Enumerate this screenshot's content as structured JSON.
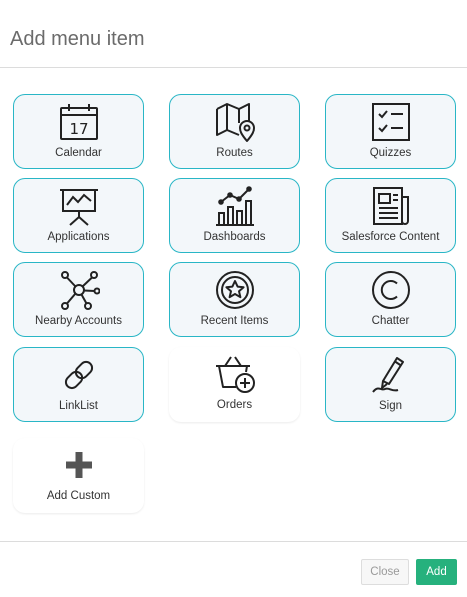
{
  "dialog": {
    "title": "Add menu item"
  },
  "tiles": [
    {
      "label": "Calendar",
      "icon": "calendar-icon",
      "calendar_day": "17",
      "selected": true
    },
    {
      "label": "Routes",
      "icon": "map-pin-icon",
      "selected": true
    },
    {
      "label": "Quizzes",
      "icon": "checklist-icon",
      "selected": true
    },
    {
      "label": "Applications",
      "icon": "presentation-chart-icon",
      "selected": true
    },
    {
      "label": "Dashboards",
      "icon": "bar-chart-icon",
      "selected": true
    },
    {
      "label": "Salesforce Content",
      "icon": "newspaper-icon",
      "selected": true
    },
    {
      "label": "Nearby Accounts",
      "icon": "network-hub-icon",
      "selected": true
    },
    {
      "label": "Recent Items",
      "icon": "star-badge-icon",
      "selected": true
    },
    {
      "label": "Chatter",
      "icon": "copyright-c-icon",
      "selected": true
    },
    {
      "label": "LinkList",
      "icon": "link-icon",
      "selected": true
    },
    {
      "label": "Orders",
      "icon": "basket-plus-icon",
      "selected": false
    },
    {
      "label": "Sign",
      "icon": "pen-sign-icon",
      "selected": true
    },
    {
      "label": "Add Custom",
      "icon": "plus-icon",
      "selected": false
    }
  ],
  "footer": {
    "close_label": "Close",
    "add_label": "Add"
  },
  "colors": {
    "tile_border": "#29b6c6",
    "tile_bg": "#f3f7fa",
    "add_button": "#26b17d"
  }
}
